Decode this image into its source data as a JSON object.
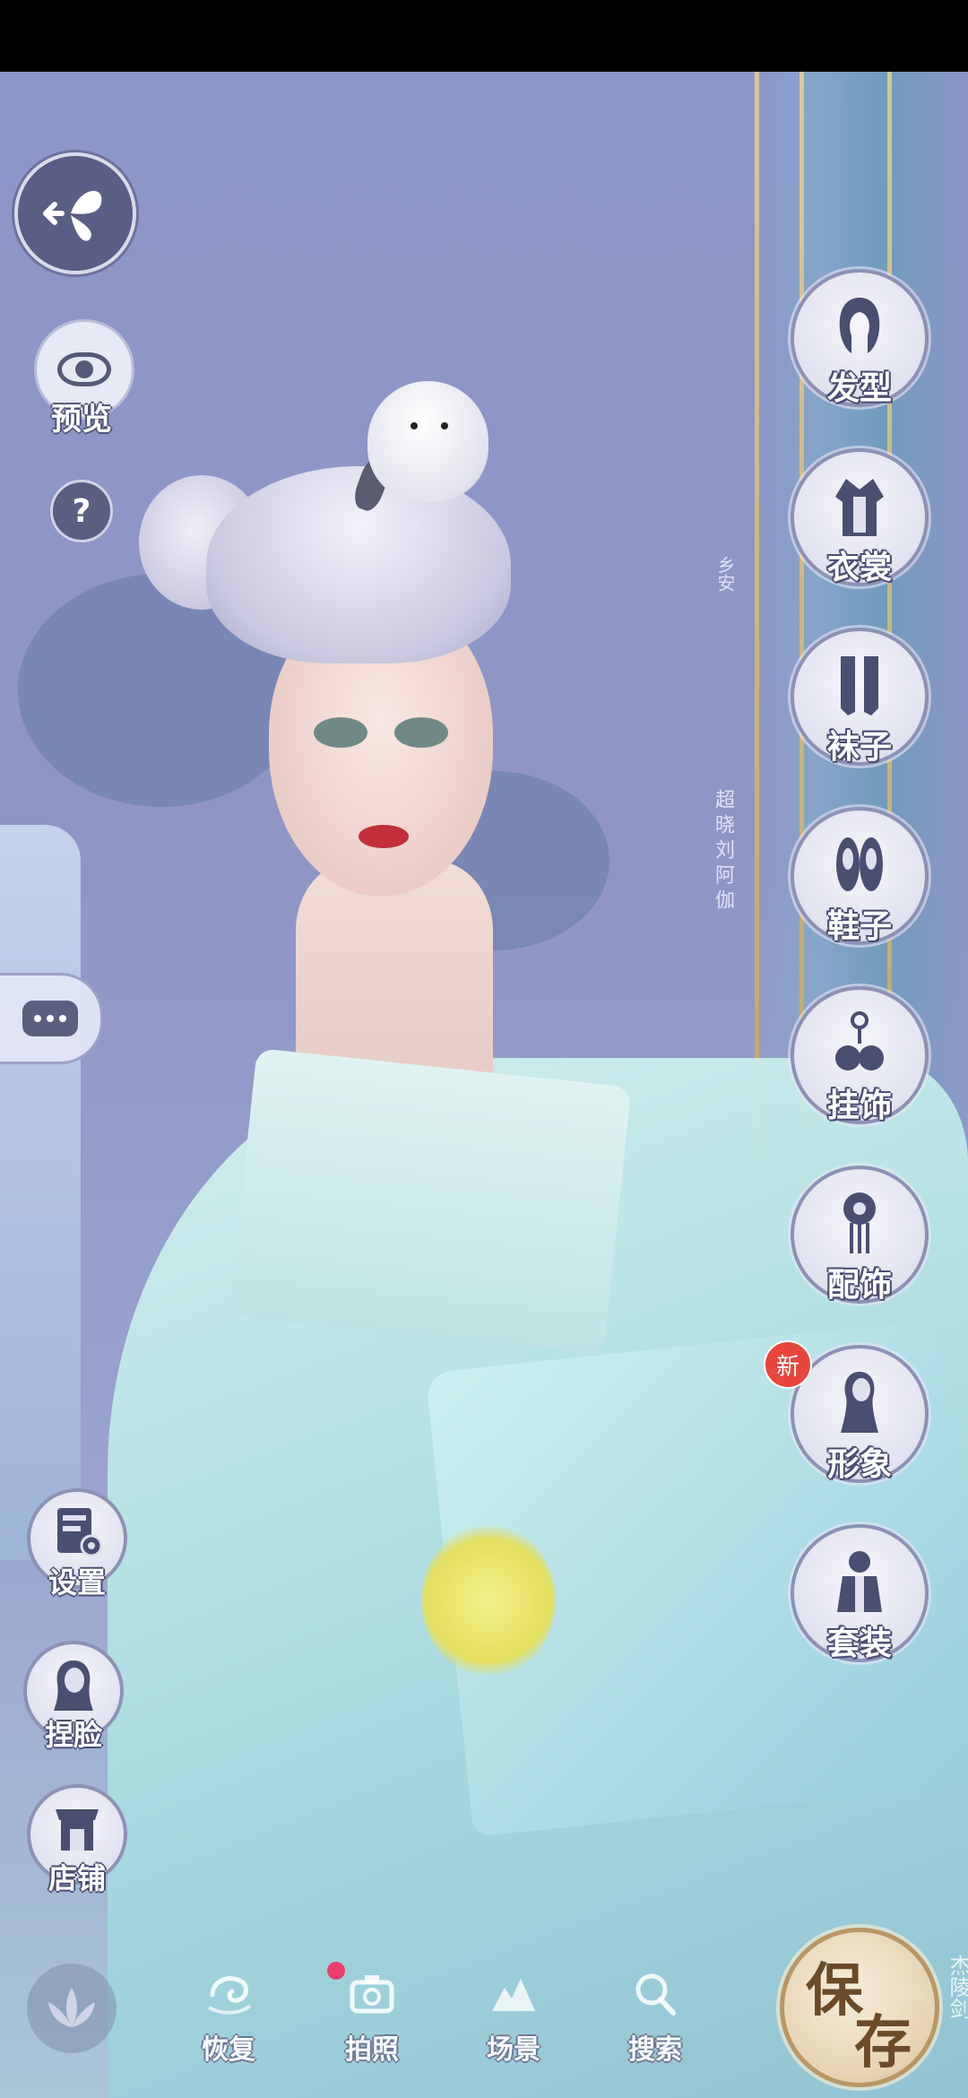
{
  "left_toolbar": {
    "preview_label": "预览",
    "help_symbol": "?"
  },
  "right_menu": [
    {
      "label": "发型",
      "icon": "hairstyle-icon"
    },
    {
      "label": "衣裳",
      "icon": "clothing-icon"
    },
    {
      "label": "袜子",
      "icon": "socks-icon"
    },
    {
      "label": "鞋子",
      "icon": "shoes-icon"
    },
    {
      "label": "挂饰",
      "icon": "pendant-icon"
    },
    {
      "label": "配饰",
      "icon": "accessory-icon"
    },
    {
      "label": "形象",
      "icon": "appearance-icon",
      "badge": "新"
    },
    {
      "label": "套装",
      "icon": "outfit-set-icon"
    }
  ],
  "left_menu": [
    {
      "label": "设置",
      "icon": "settings-icon"
    },
    {
      "label": "捏脸",
      "icon": "face-customize-icon"
    },
    {
      "label": "店铺",
      "icon": "shop-icon"
    }
  ],
  "bottom_tabs": [
    {
      "label": "恢复",
      "icon": "restore-icon"
    },
    {
      "label": "拍照",
      "icon": "camera-icon"
    },
    {
      "label": "场景",
      "icon": "scene-icon"
    },
    {
      "label": "搜索",
      "icon": "search-icon"
    }
  ],
  "save_button": {
    "char1": "保",
    "char2": "存"
  },
  "scene_text": {
    "calligraphy_main": "超晓刘阿伽",
    "calligraphy_small": "乡安",
    "corner_text": "杰陵剑"
  },
  "colors": {
    "background": "#8f96c6",
    "icon_dark": "#4a4f72",
    "badge": "#e8453c",
    "save_gold": "#b99663"
  }
}
